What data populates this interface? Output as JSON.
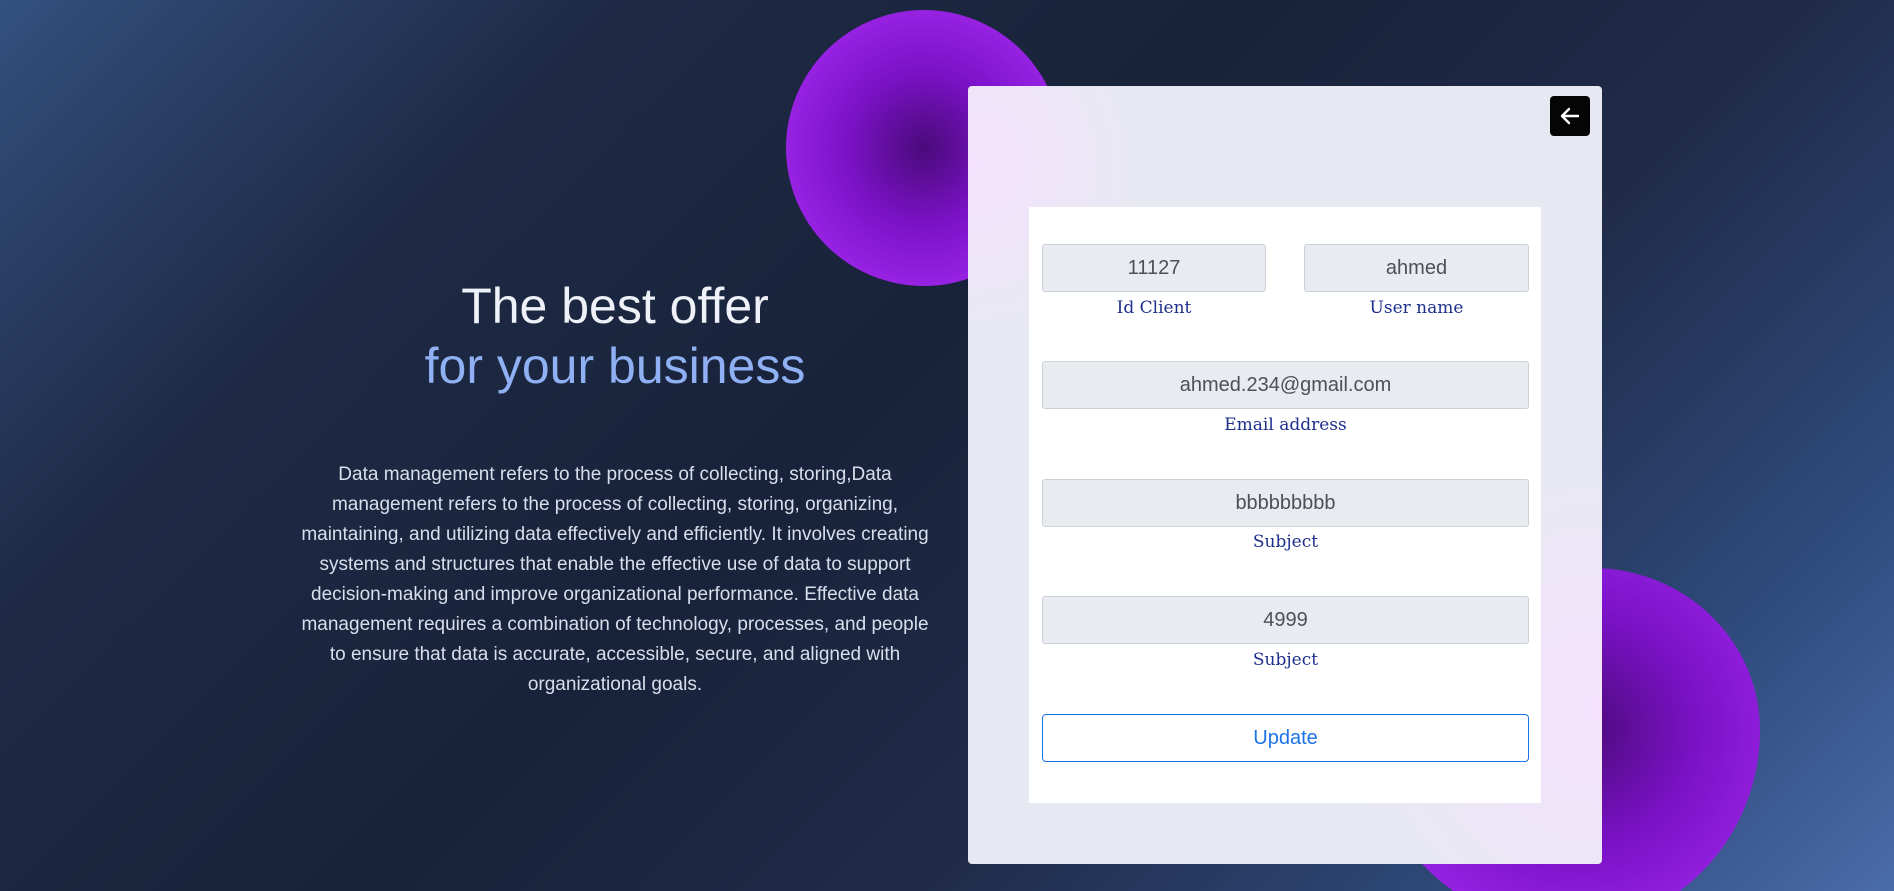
{
  "hero": {
    "title": "The best offer",
    "subtitle": "for your business",
    "description": "Data management refers to the process of collecting, storing,Data management refers to the process of collecting, storing, organizing, maintaining, and utilizing data effectively and efficiently. It involves creating systems and structures that enable the effective use of data to support decision-making and improve organizational performance. Effective data management requires a combination of technology, processes, and people to ensure that data is accurate, accessible, secure, and aligned with organizational goals."
  },
  "form": {
    "back_icon": "arrow-left-icon",
    "id_client": {
      "value": "11127",
      "label": "Id Client"
    },
    "user_name": {
      "value": "ahmed",
      "label": "User name"
    },
    "email": {
      "value": "ahmed.234@gmail.com",
      "label": "Email address"
    },
    "subject1": {
      "value": "bbbbbbbbb",
      "label": "Subject"
    },
    "subject2": {
      "value": "4999",
      "label": "Subject"
    },
    "update_label": "Update"
  },
  "colors": {
    "accent": "#1a73e8",
    "label": "#1e2f8c",
    "blob": "#9b24e6",
    "subtitle": "#8fb0f2"
  }
}
